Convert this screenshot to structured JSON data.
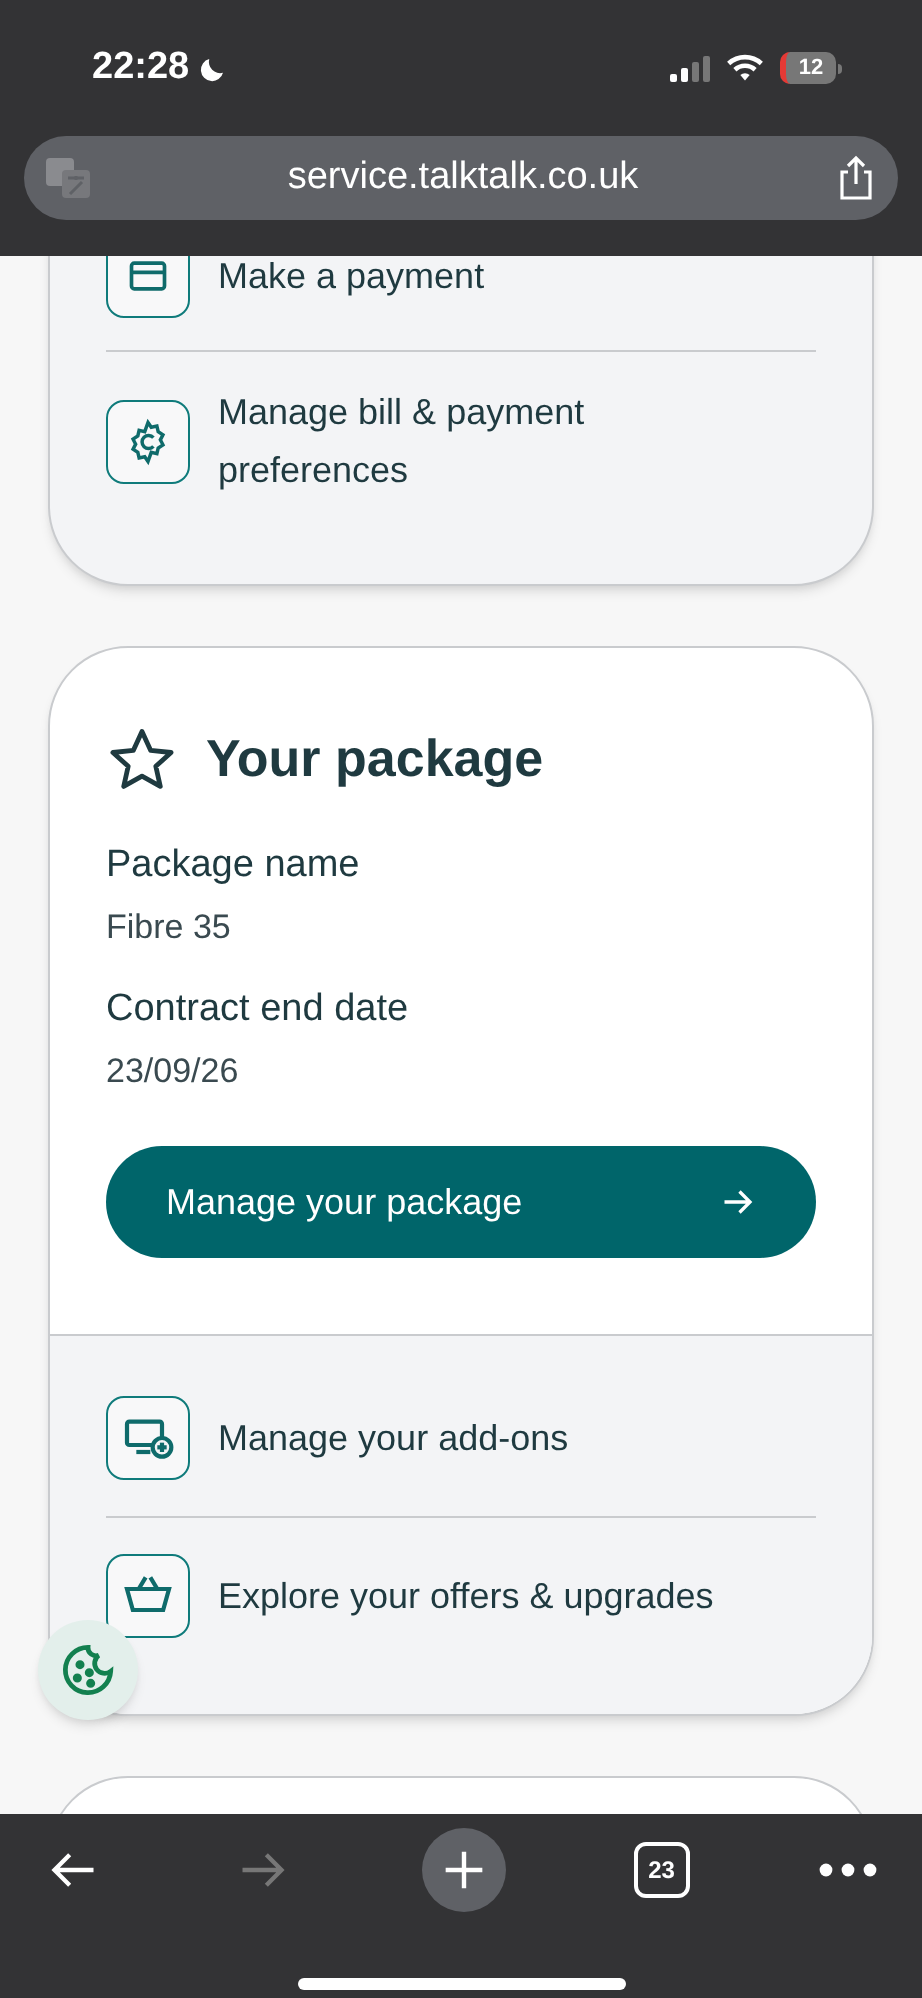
{
  "status_bar": {
    "time": "22:28",
    "battery": "12"
  },
  "browser": {
    "url": "service.talktalk.co.uk"
  },
  "billing_card": {
    "items": [
      {
        "label": "Make a payment"
      },
      {
        "label": "Manage bill & payment preferences"
      }
    ]
  },
  "package_card": {
    "title": "Your package",
    "fields": [
      {
        "label": "Package name",
        "value": "Fibre 35"
      },
      {
        "label": "Contract end date",
        "value": "23/09/26"
      }
    ],
    "button": "Manage your package",
    "links": [
      {
        "label": "Manage your add-ons"
      },
      {
        "label": "Explore your offers & upgrades"
      }
    ]
  },
  "toolbar": {
    "back_disabled": false,
    "forward_disabled": true,
    "tabs_count": "23"
  }
}
